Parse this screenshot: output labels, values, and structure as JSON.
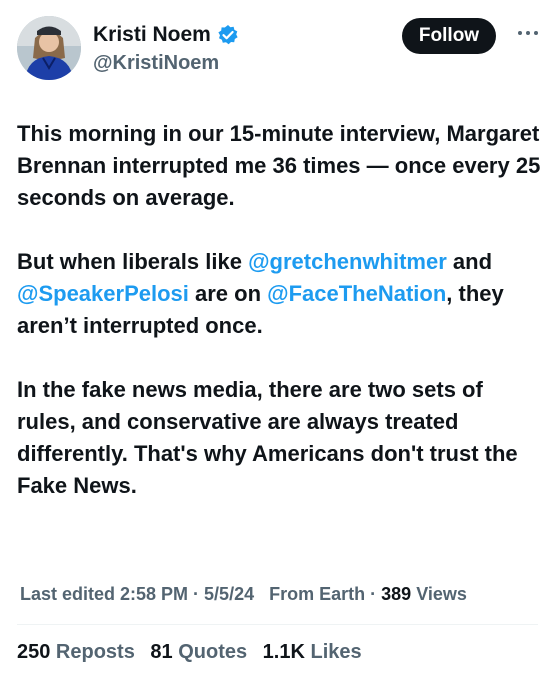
{
  "author": {
    "display_name": "Kristi Noem",
    "handle": "@KristiNoem",
    "verified": "blue-checkmark-icon"
  },
  "follow_button": {
    "label": "Follow"
  },
  "more_button": {
    "icon": "more-horizontal-icon"
  },
  "tweet": {
    "p1": "This morning in our 15-minute interview, Margaret Brennan interrupted me 36 times — once every 25 seconds on average.",
    "p2_a": "But when liberals like ",
    "p2_mention1": "@gretchenwhitmer",
    "p2_b": " and ",
    "p2_mention2": "@SpeakerPelosi",
    "p2_c": " are on ",
    "p2_mention3": "@FaceTheNation",
    "p2_d": ", they aren’t interrupted once.",
    "p3": "In the fake news media, there are two sets of rules, and conservative are always treated differently. That's why Americans don't trust the Fake News."
  },
  "meta": {
    "edited": "Last edited 2:58 PM · 5/5/24",
    "source": "From Earth",
    "sep": " · ",
    "views_count": "389",
    "views_label": " Views"
  },
  "stats": {
    "reposts_count": "250",
    "reposts_label": " Reposts",
    "quotes_count": "81",
    "quotes_label": " Quotes",
    "likes_count": "1.1K",
    "likes_label": " Likes"
  },
  "colors": {
    "accent": "#1d9bf0",
    "text": "#0f1419",
    "secondary": "#536471"
  }
}
